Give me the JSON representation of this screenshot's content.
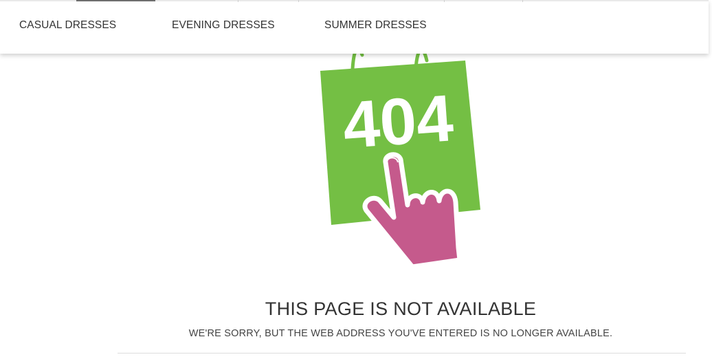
{
  "nav": {
    "items": [
      {
        "label": "CASUAL DRESSES"
      },
      {
        "label": "EVENING DRESSES"
      },
      {
        "label": "SUMMER DRESSES"
      }
    ]
  },
  "error": {
    "code": "404",
    "title": "THIS PAGE IS NOT AVAILABLE",
    "message": "WE'RE SORRY, BUT THE WEB ADDRESS YOU'VE ENTERED IS NO LONGER AVAILABLE."
  },
  "colors": {
    "bag_green": "#74bf44",
    "hand_pink": "#c55a8c",
    "text": "#333333"
  },
  "icons": {
    "illustration": "shopping-bag-404-icon",
    "pointer": "pointing-hand-icon"
  }
}
